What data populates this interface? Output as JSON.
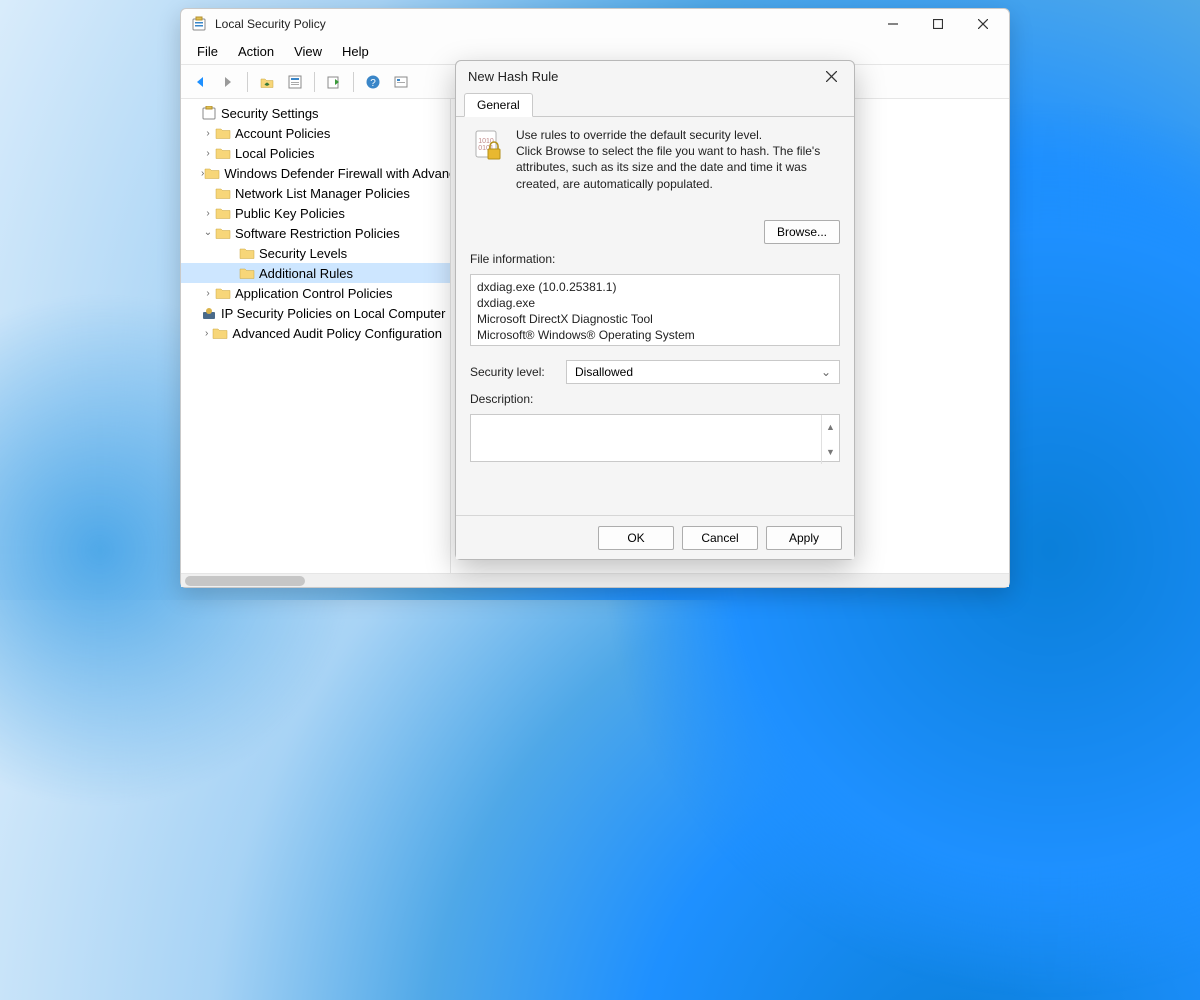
{
  "window": {
    "title": "Local Security Policy",
    "menu": {
      "file": "File",
      "action": "Action",
      "view": "View",
      "help": "Help"
    }
  },
  "tree": {
    "root": "Security Settings",
    "items": [
      {
        "label": "Account Policies",
        "expandable": true
      },
      {
        "label": "Local Policies",
        "expandable": true
      },
      {
        "label": "Windows Defender Firewall with Advanced Security",
        "expandable": true
      },
      {
        "label": "Network List Manager Policies",
        "expandable": false
      },
      {
        "label": "Public Key Policies",
        "expandable": true
      },
      {
        "label": "Software Restriction Policies",
        "expandable": true,
        "expanded": true,
        "children": [
          {
            "label": "Security Levels"
          },
          {
            "label": "Additional Rules",
            "selected": true
          }
        ]
      },
      {
        "label": "Application Control Policies",
        "expandable": true
      },
      {
        "label": "IP Security Policies on Local Computer",
        "expandable": false
      },
      {
        "label": "Advanced Audit Policy Configuration",
        "expandable": true
      }
    ]
  },
  "dialog": {
    "title": "New Hash Rule",
    "tab": "General",
    "intro1": "Use rules to override the default security level.",
    "intro2": "Click Browse to select the file you want to hash. The file's attributes, such as its size and the date and time it was created, are automatically populated.",
    "browse": "Browse...",
    "file_info_label": "File information:",
    "file_info": "dxdiag.exe (10.0.25381.1)\ndxdiag.exe\nMicrosoft DirectX Diagnostic Tool\nMicrosoft® Windows® Operating System",
    "sec_level_label": "Security level:",
    "sec_level_value": "Disallowed",
    "desc_label": "Description:",
    "desc_value": "",
    "ok": "OK",
    "cancel": "Cancel",
    "apply": "Apply"
  }
}
